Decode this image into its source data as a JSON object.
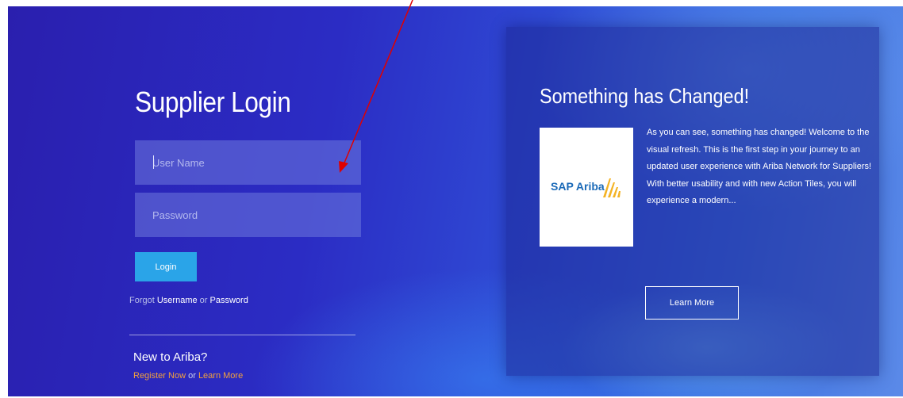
{
  "login": {
    "title": "Supplier Login",
    "username_placeholder": "User Name",
    "password_placeholder": "Password",
    "login_button": "Login",
    "forgot_prefix": "Forgot",
    "forgot_username": "Username",
    "forgot_or": "or",
    "forgot_password": "Password"
  },
  "new_user": {
    "title": "New to Ariba?",
    "register": "Register Now",
    "or": "or",
    "learn_more": "Learn More"
  },
  "info": {
    "title": "Something has Changed!",
    "logo_text": "SAP Ariba",
    "body": "As you can see, something has changed! Welcome to the visual refresh. This is the first step in your journey to an updated user experience with Ariba Network for Suppliers! With better usability and with new Action Tiles, you will experience a modern...",
    "learn_more_button": "Learn More"
  },
  "colors": {
    "login_button": "#2aa4e8",
    "link_orange": "#f2a03d",
    "annotation_arrow": "#e00000",
    "logo_blue": "#1b6ab8",
    "logo_gold": "#f4b324"
  }
}
